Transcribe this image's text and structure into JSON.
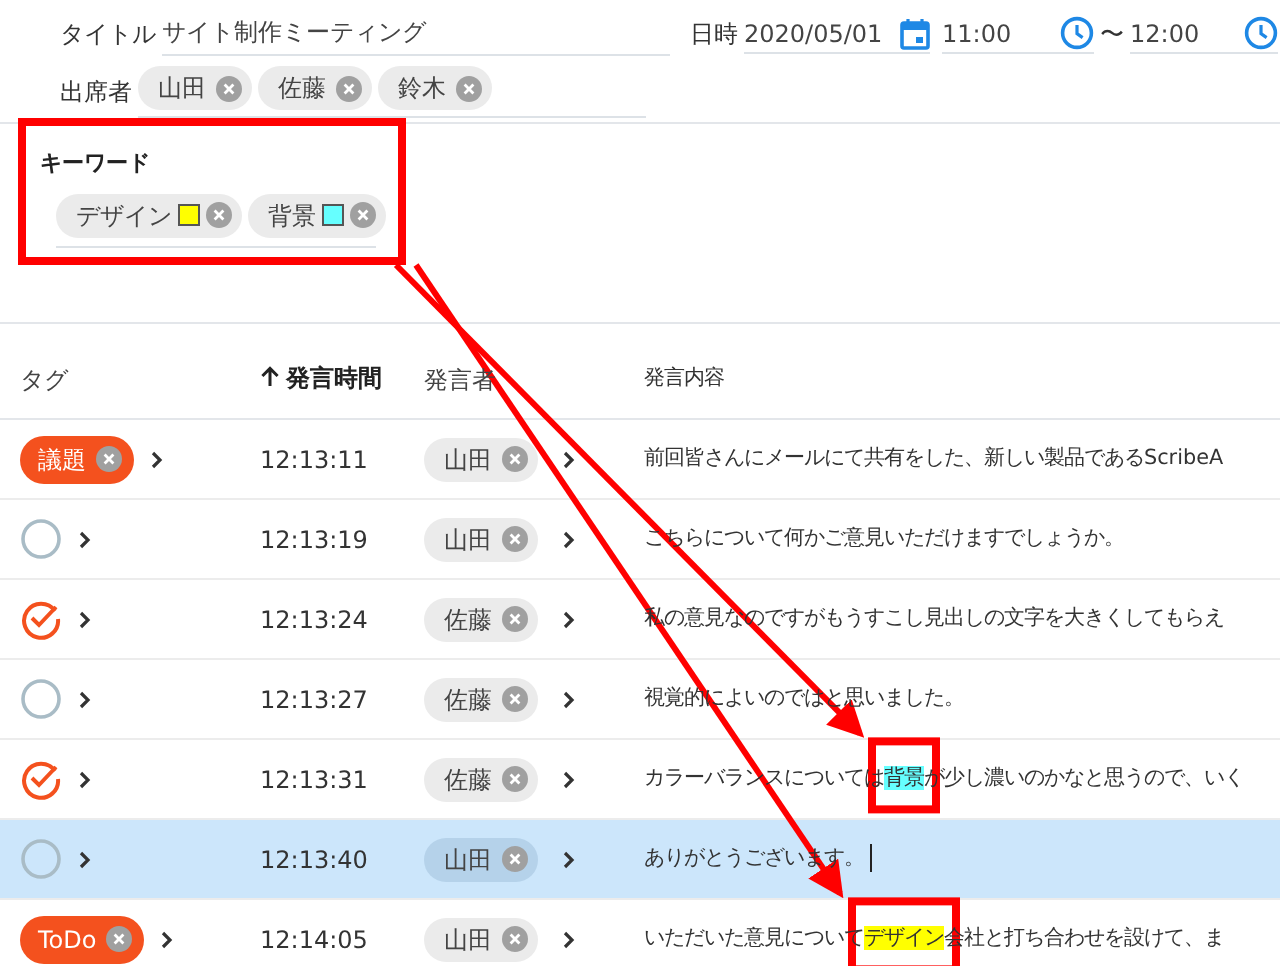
{
  "meeting": {
    "title_label": "タイトル",
    "title": "サイト制作ミーティング",
    "datetime_label": "日時",
    "date": "2020/05/01",
    "start_time": "11:00",
    "range_separator": "〜",
    "end_time": "12:00",
    "attendees_label": "出席者",
    "attendees": [
      "山田",
      "佐藤",
      "鈴木"
    ]
  },
  "keywords": {
    "label": "キーワード",
    "items": [
      {
        "text": "デザイン",
        "color": "#ffff00"
      },
      {
        "text": "背景",
        "color": "#66ffff"
      }
    ]
  },
  "table": {
    "columns": [
      {
        "label": "タグ",
        "sorted": false
      },
      {
        "label": "発言時間",
        "sorted": true
      },
      {
        "label": "発言者",
        "sorted": false
      },
      {
        "label": "発言内容",
        "sorted": false
      }
    ],
    "rows": [
      {
        "tag": {
          "kind": "label",
          "text": "議題"
        },
        "time": "12:13:11",
        "speaker": "山田",
        "selected": false,
        "cursor": false,
        "content": [
          {
            "text": "前回皆さんにメールにて共有をした、新しい製品であるScribeA"
          }
        ]
      },
      {
        "tag": {
          "kind": "check",
          "checked": false
        },
        "time": "12:13:19",
        "speaker": "山田",
        "selected": false,
        "cursor": false,
        "content": [
          {
            "text": "こちらについて何かご意見いただけますでしょうか。"
          }
        ]
      },
      {
        "tag": {
          "kind": "check",
          "checked": true
        },
        "time": "12:13:24",
        "speaker": "佐藤",
        "selected": false,
        "cursor": false,
        "content": [
          {
            "text": "私の意見なのですがもうすこし見出しの文字を大きくしてもらえ"
          }
        ]
      },
      {
        "tag": {
          "kind": "check",
          "checked": false
        },
        "time": "12:13:27",
        "speaker": "佐藤",
        "selected": false,
        "cursor": false,
        "content": [
          {
            "text": "視覚的によいのではと思いました。"
          }
        ]
      },
      {
        "tag": {
          "kind": "check",
          "checked": true
        },
        "time": "12:13:31",
        "speaker": "佐藤",
        "selected": false,
        "cursor": false,
        "content": [
          {
            "text": "カラーバランスについては"
          },
          {
            "text": "背景",
            "color": "#66ffff"
          },
          {
            "text": "が少し濃いのかなと思うので、いく"
          }
        ]
      },
      {
        "tag": {
          "kind": "check",
          "checked": false
        },
        "time": "12:13:40",
        "speaker": "山田",
        "selected": true,
        "cursor": true,
        "content": [
          {
            "text": "ありがとうございます。"
          }
        ]
      },
      {
        "tag": {
          "kind": "label",
          "text": "ToDo"
        },
        "time": "12:14:05",
        "speaker": "山田",
        "selected": false,
        "cursor": false,
        "content": [
          {
            "text": "いただいた意見について"
          },
          {
            "text": "デザイン",
            "color": "#ffff00"
          },
          {
            "text": "会社と打ち合わせを設けて、ま"
          }
        ]
      }
    ]
  }
}
